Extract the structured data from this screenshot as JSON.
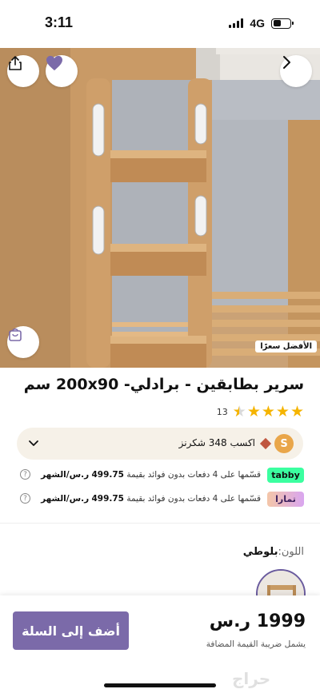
{
  "status_bar": {
    "time": "3:11",
    "network": "4G"
  },
  "product": {
    "best_seller_badge": "الأفضل سعرًا",
    "title": "سرير بطابقين - برادلي- 200x90 سم",
    "rating": 4.5,
    "review_count": "13",
    "loyalty_text": "اكسب 348 شكرنز",
    "loyalty_logo": "S"
  },
  "installments": [
    {
      "provider": "tabby",
      "text": "قسّمها على 4 دفعات بدون فوائد بقيمة",
      "amount": "499.75",
      "unit": "ر.س/الشهر"
    },
    {
      "provider": "تمارا",
      "text": "قسّمها على 4 دفعات بدون فوائد بقيمة",
      "amount": "499.75",
      "unit": "ر.س/الشهر"
    }
  ],
  "color": {
    "label": "اللون:",
    "value": "بلوطي"
  },
  "purchase": {
    "add_to_cart_label": "أضف إلى السلة",
    "price": "1999 ر.س",
    "vat_note": "يشمل ضريبة القيمة المضافة"
  },
  "watermark": "حراج",
  "theme": {
    "accent": "#7b6aa9",
    "star": "#f5b400",
    "tabby": "#3bffa0"
  }
}
